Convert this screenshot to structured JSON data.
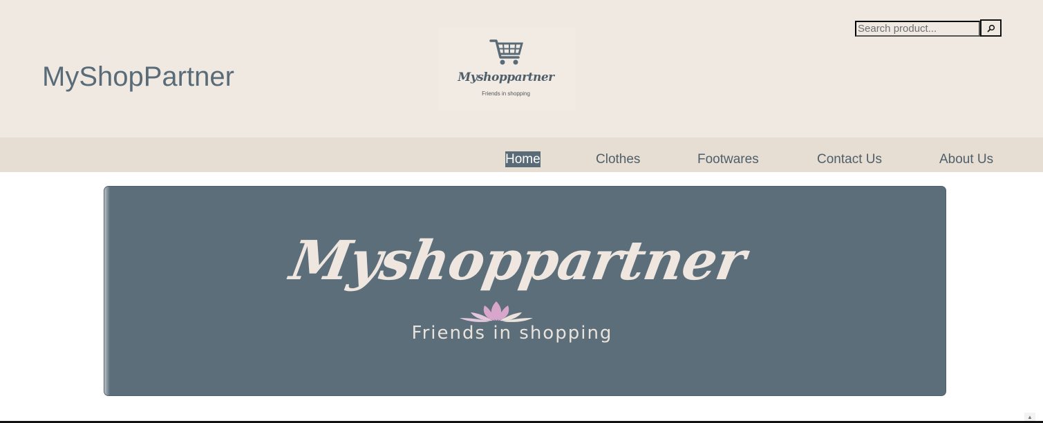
{
  "header": {
    "site_title": "MyShopPartner",
    "logo": {
      "name": "Myshoppartner",
      "tagline": "Friends in shopping",
      "icon": "shopping-cart-icon"
    },
    "search": {
      "placeholder": "Search product...",
      "value": "",
      "button_icon": "search-icon"
    }
  },
  "nav": {
    "items": [
      {
        "label": "Home",
        "active": true
      },
      {
        "label": "Clothes",
        "active": false
      },
      {
        "label": "Footwares",
        "active": false
      },
      {
        "label": "Contact Us",
        "active": false
      },
      {
        "label": "About Us",
        "active": false
      }
    ]
  },
  "banner": {
    "title": "Myshoppartner",
    "subtitle": "Friends in shopping",
    "icon": "lotus-icon"
  },
  "colors": {
    "header_bg": "#efe9e2",
    "nav_bg": "#e6ddd3",
    "accent": "#5a6b78",
    "banner_bg": "#5b6e7a"
  }
}
